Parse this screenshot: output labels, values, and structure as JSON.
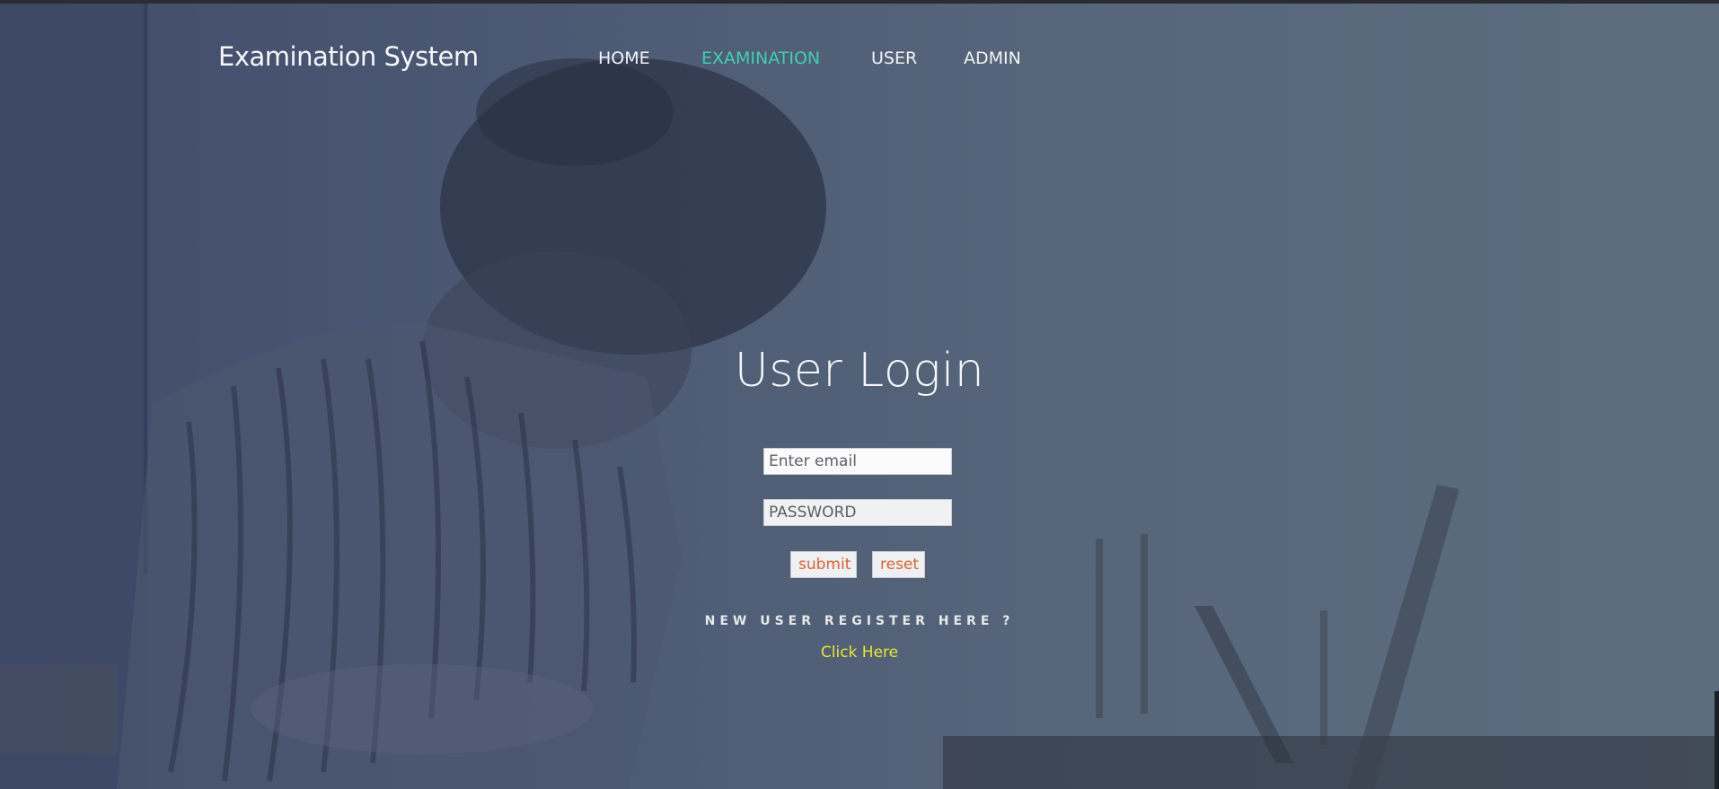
{
  "brand": {
    "title": "Examination System"
  },
  "nav": {
    "items": [
      {
        "label": "HOME",
        "active": false
      },
      {
        "label": "EXAMINATION",
        "active": true
      },
      {
        "label": "USER",
        "active": false
      },
      {
        "label": "ADMIN",
        "active": false
      }
    ]
  },
  "login": {
    "title": "User Login",
    "email": {
      "value": "",
      "placeholder": "Enter email"
    },
    "password": {
      "value": "",
      "placeholder": "PASSWORD"
    },
    "submit_label": "submit",
    "reset_label": "reset"
  },
  "register": {
    "prompt": "NEW USER REGISTER HERE ?",
    "link_label": "Click Here"
  },
  "colors": {
    "active_nav": "#3ed0b0",
    "button_text": "#e4602a",
    "register_link": "#e8e630"
  }
}
